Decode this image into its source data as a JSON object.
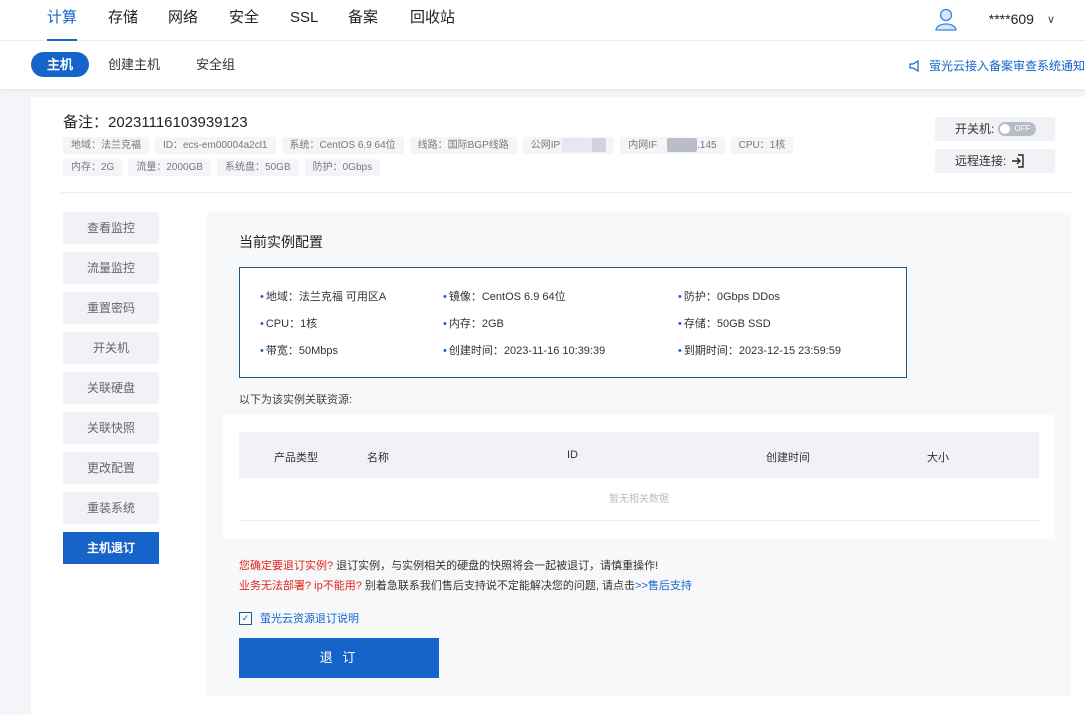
{
  "topnav": {
    "items": [
      "计算",
      "存储",
      "网络",
      "安全",
      "SSL",
      "备案",
      "回收站"
    ],
    "username": "****609"
  },
  "subnav": {
    "tabs": [
      "主机",
      "创建主机",
      "安全组"
    ],
    "notice": "萤光云接入备案审查系统通知"
  },
  "instance": {
    "remark_label": "备注：",
    "remark_value": "20231116103939123",
    "tags": {
      "region": "地域：法兰克福",
      "id": "ID：ecs-em00004a2cl1",
      "os": "系统：CentOS 6.9 64位",
      "line": "线路：国际BGP线路",
      "public_ip_label": "公网IP",
      "private_ip_label": "内网IF",
      "private_ip_suffix": ".145",
      "cpu": "CPU：1核",
      "memory": "内存：2G",
      "traffic": "流量：2000GB",
      "disk": "系统盘：50GB",
      "protect": "防护：0Gbps"
    }
  },
  "actions": {
    "power_label": "开关机:",
    "power_state": "OFF",
    "remote_label": "远程连接:"
  },
  "menu": [
    "查看监控",
    "流量监控",
    "重置密码",
    "开关机",
    "关联硬盘",
    "关联快照",
    "更改配置",
    "重装系统",
    "主机退订"
  ],
  "panel": {
    "title": "当前实例配置",
    "config": {
      "region": "地域：法兰克福  可用区A",
      "image": "镜像：CentOS 6.9 64位",
      "protect": "防护：0Gbps DDos",
      "cpu": "CPU：1核",
      "memory": "内存：2GB",
      "storage": "存储：50GB SSD",
      "bandwidth": "带宽：50Mbps",
      "created": "创建时间：2023-11-16 10:39:39",
      "expires": "到期时间：2023-12-15 23:59:59"
    },
    "related_note": "以下为该实例关联资源:",
    "table": {
      "headers": [
        "产品类型",
        "名称",
        "ID",
        "创建时间",
        "大小"
      ],
      "empty": "暂无相关数据"
    },
    "warning1_red": "您确定要退订实例?",
    "warning1_text": " 退订实例，与实例相关的硬盘的快照将会一起被退订，请慎重操作!",
    "warning2_red": "业务无法部署? ip不能用?",
    "warning2_text": " 别着急联系我们售后支持说不定能解决您的问题, 请点击",
    "warning2_link": ">>售后支持",
    "agree_label": "萤光云资源退订说明",
    "submit_label": "退 订"
  },
  "colors": {
    "accent": "#1664c9",
    "warn": "#e1251b",
    "border": "#1c5a8c"
  }
}
